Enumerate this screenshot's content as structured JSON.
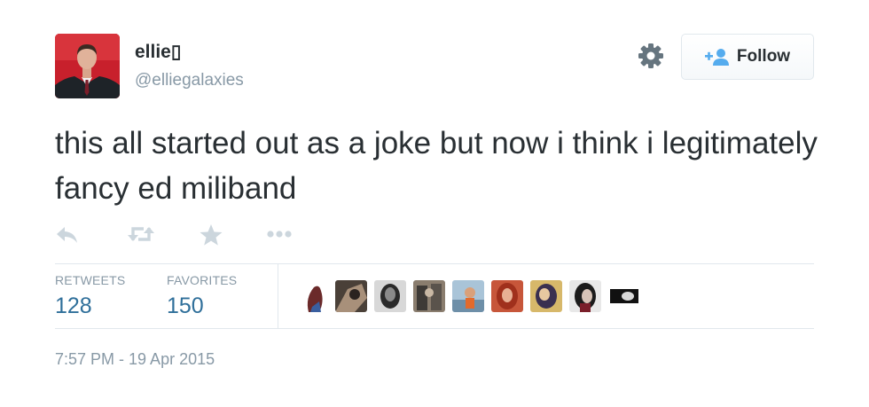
{
  "user": {
    "name": "ellie▯",
    "handle": "@elliegalaxies"
  },
  "header": {
    "gear_icon": "gear-icon",
    "follow_label": "Follow",
    "follow_icon": "add-person-icon"
  },
  "tweet": {
    "text": "this all started out as a joke but now i think i legitimately fancy ed miliband"
  },
  "actions": [
    "reply-icon",
    "retweet-icon",
    "favorite-star-icon",
    "more-dots-icon"
  ],
  "stats": {
    "retweets_label": "RETWEETS",
    "retweets_value": "128",
    "favorites_label": "FAVORITES",
    "favorites_value": "150"
  },
  "timestamp": "7:57 PM - 19 Apr 2015",
  "colors": {
    "text": "#292f33",
    "muted": "#8899a6",
    "stat_value": "#2f6f9a",
    "border": "#e1e8ed",
    "follow_icon": "#55acee"
  }
}
